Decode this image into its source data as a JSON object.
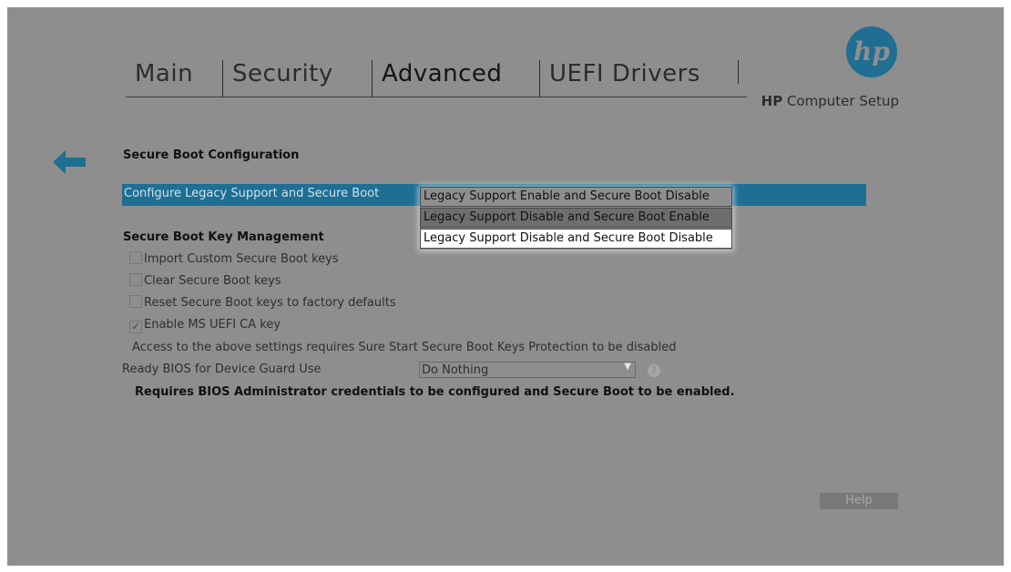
{
  "tabs": [
    {
      "label": "Main"
    },
    {
      "label": "Security"
    },
    {
      "label": "Advanced"
    },
    {
      "label": "UEFI Drivers"
    }
  ],
  "brand": {
    "logo_text": "hp",
    "subtitle_bold": "HP",
    "subtitle_rest": " Computer Setup",
    "accent": "#1e6f93"
  },
  "icons": {
    "back": "arrow-left-icon",
    "help": "question-circle-icon"
  },
  "section_secure_boot_config": "Secure Boot Configuration",
  "legacy_support": {
    "label": "Configure Legacy Support and Secure Boot",
    "options": [
      "Legacy Support Enable and Secure Boot Disable",
      "Legacy Support Disable and Secure Boot Enable",
      "Legacy Support Disable and Secure Boot Disable"
    ],
    "selected": "Legacy Support Disable and Secure Boot Enable",
    "hovered": "Legacy Support Disable and Secure Boot Disable"
  },
  "section_key_management": "Secure Boot Key Management",
  "key_options": [
    {
      "label": "Import Custom Secure Boot keys",
      "checked": false
    },
    {
      "label": "Clear Secure Boot keys",
      "checked": false
    },
    {
      "label": "Reset Secure Boot keys to factory defaults",
      "checked": false
    },
    {
      "label": "Enable MS UEFI CA key",
      "checked": true
    }
  ],
  "checkmark": "✓",
  "sure_start_note": "Access to the above settings requires Sure Start Secure Boot Keys Protection to be disabled",
  "device_guard": {
    "label": "Ready BIOS for Device Guard Use",
    "value": "Do Nothing",
    "help_glyph": "?"
  },
  "admin_note": "Requires BIOS Administrator credentials to be configured and Secure Boot to be enabled.",
  "help_button": "Help"
}
